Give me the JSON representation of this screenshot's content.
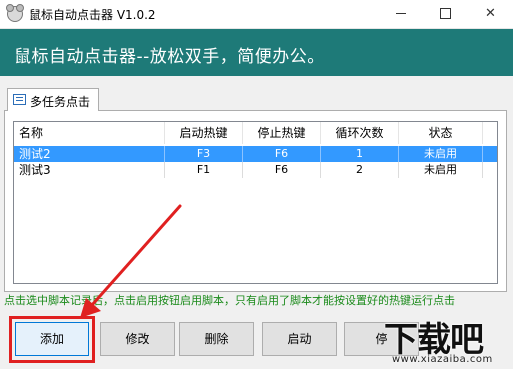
{
  "window": {
    "title": "鼠标自动点击器 V1.0.2",
    "minimize_glyph": "",
    "maximize_glyph": "",
    "close_glyph": "✕"
  },
  "banner": {
    "text": "鼠标自动点击器--放松双手，简便办公。"
  },
  "tab": {
    "label": "多任务点击"
  },
  "list": {
    "columns": [
      "名称",
      "启动热键",
      "停止热键",
      "循环次数",
      "状态"
    ],
    "rows": [
      {
        "name": "测试2",
        "start_key": "F3",
        "stop_key": "F6",
        "loops": "1",
        "status": "未启用",
        "selected": true
      },
      {
        "name": "测试3",
        "start_key": "F1",
        "stop_key": "F6",
        "loops": "2",
        "status": "未启用",
        "selected": false
      }
    ]
  },
  "hint": {
    "text": "点击选中脚本记录后，点击启用按钮启用脚本，只有启用了脚本才能按设置好的热键运行点击"
  },
  "buttons": {
    "add": "添加",
    "edit": "修改",
    "delete": "删除",
    "start": "启动",
    "stop": "停"
  },
  "watermark": {
    "main": "下载吧",
    "sub": "www.xiazaiba.com"
  },
  "colors": {
    "banner": "#1e7a78",
    "selection": "#3399ff",
    "hint": "#1a8a1a",
    "annotation": "#e02020"
  }
}
